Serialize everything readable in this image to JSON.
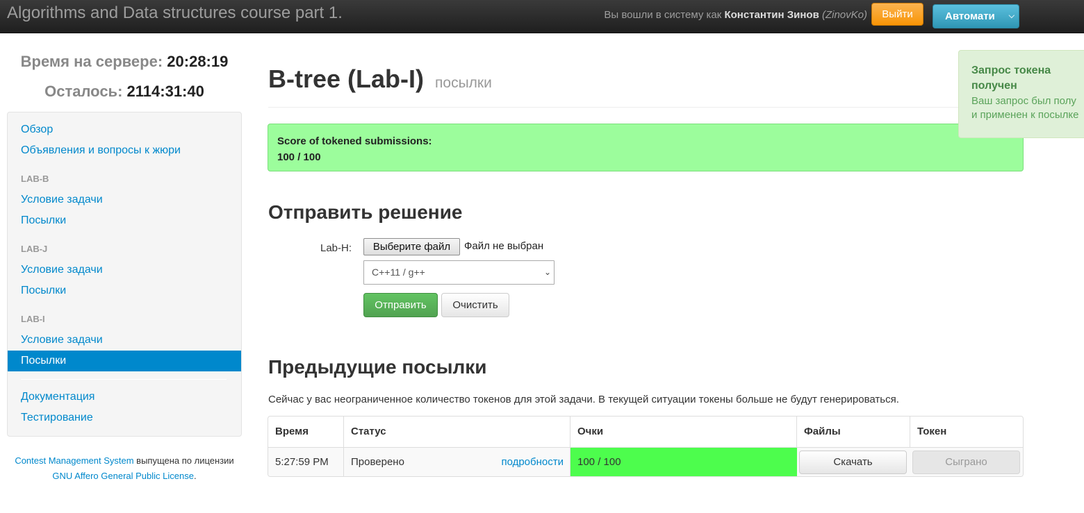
{
  "navbar": {
    "brand": "Algorithms and Data structures course part 1.",
    "login_prefix": "Вы вошли в систему как",
    "user_name": "Константин Зинов",
    "username": "(ZinovKo)",
    "logout_label": "Выйти",
    "language_label": "Автомати"
  },
  "sidebar": {
    "server_time_label": "Время на сервере:",
    "server_time_value": "20:28:19",
    "remaining_label": "Осталось:",
    "remaining_value": "2114:31:40",
    "overview": "Обзор",
    "announcements": "Объявления и вопросы к жюри",
    "sections": [
      {
        "header": "LAB-B",
        "statement": "Условие задачи",
        "submissions": "Посылки"
      },
      {
        "header": "LAB-J",
        "statement": "Условие задачи",
        "submissions": "Посылки"
      },
      {
        "header": "LAB-I",
        "statement": "Условие задачи",
        "submissions": "Посылки"
      }
    ],
    "documentation": "Документация",
    "testing": "Тестирование"
  },
  "footer": {
    "cms_link": "Contest Management System",
    "text_middle": " выпущена по лицензии ",
    "license_link": "GNU Affero General Public License",
    "text_end": "."
  },
  "main": {
    "title": "B-tree (Lab-I)",
    "title_sub": "посылки",
    "score_label": "Score of tokened submissions:",
    "score_value": "100 / 100",
    "submit_heading": "Отправить решение",
    "file_label": "Lab-H:",
    "file_button": "Выберите файл",
    "file_status": "Файл не выбран",
    "language_selected": "C++11 / g++",
    "submit_button": "Отправить",
    "clear_button": "Очистить",
    "previous_heading": "Предыдущие посылки",
    "tokens_note": "Сейчас у вас неограниченное количество токенов для этой задачи. В текущей ситуации токены больше не будут генерироваться."
  },
  "table": {
    "headers": [
      "Время",
      "Статус",
      "Очки",
      "Файлы",
      "Токен"
    ],
    "rows": [
      {
        "time": "5:27:59 PM",
        "status": "Проверено",
        "details": "подробности",
        "score": "100 / 100",
        "download": "Скачать",
        "token": "Сыграно"
      }
    ]
  },
  "notification": {
    "title_line1": "Запрос токена",
    "title_line2": "получен",
    "body_line1": "Ваш запрос был полу",
    "body_line2": "и применен к посылке"
  },
  "colors": {
    "link": "#0088cc",
    "score_box": "#9cfd9c",
    "score_cell": "#4dfd4d",
    "logout": "#f89406",
    "language": "#2f96b4",
    "submit": "#51a351"
  }
}
